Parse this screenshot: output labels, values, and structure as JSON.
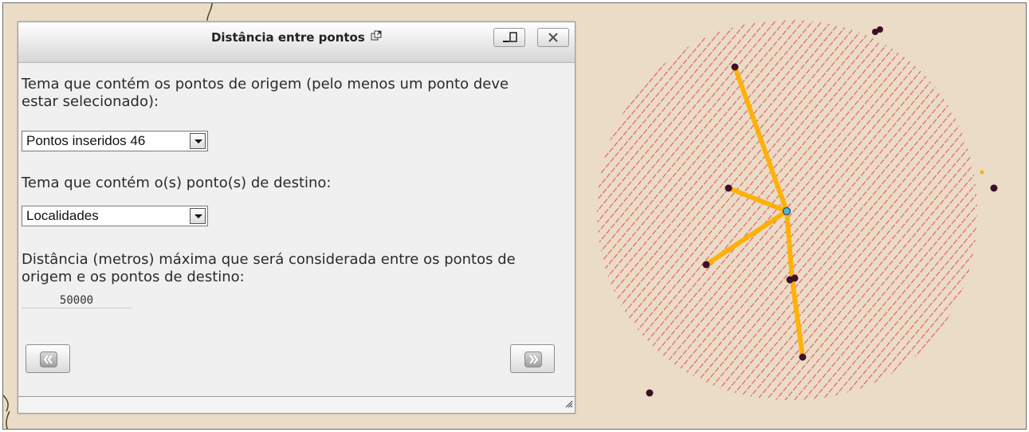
{
  "dialog": {
    "title": "Distância entre pontos",
    "origin_label": "Tema que contém os pontos de origem (pelo menos um ponto deve estar selecionado):",
    "origin_select_value": "Pontos inseridos 46",
    "destination_label": "Tema que contém o(s) ponto(s) de destino:",
    "destination_select_value": "Localidades",
    "distance_label": "Distância (metros) máxima que será considerada entre os pontos de origem e os pontos de destino:",
    "distance_value": "50000"
  },
  "icons": {
    "popout": "popout-icon",
    "minimize": "minimize-icon",
    "close": "close-icon",
    "previous": "double-chevron-left-icon",
    "next": "double-chevron-right-icon",
    "resize": "resize-grip-icon"
  },
  "colors": {
    "map_background": "#eadcc6",
    "buffer_hatch": "#e8585a",
    "route_line": "#ffb000",
    "point": "#3d1026",
    "origin_point": "#4fb6d8"
  }
}
